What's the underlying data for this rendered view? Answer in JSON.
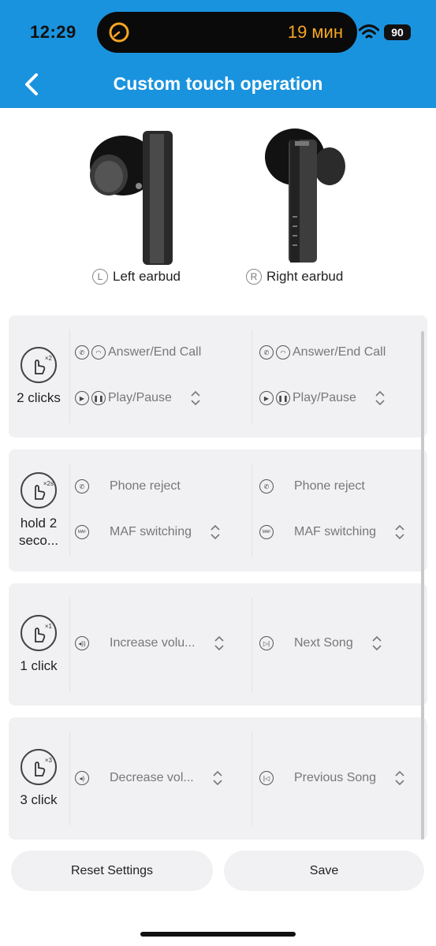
{
  "status": {
    "time": "12:29",
    "island_text": "19 мин",
    "battery": "90"
  },
  "header": {
    "title": "Custom touch operation"
  },
  "earbuds": {
    "left_letter": "L",
    "left_label": "Left earbud",
    "right_letter": "R",
    "right_label": "Right earbud"
  },
  "cards": [
    {
      "gesture_badge": "×2",
      "gesture_label": "2 clicks",
      "left": [
        {
          "icons": [
            "phone-icon",
            "hangup-icon"
          ],
          "text": "Answer/End Call"
        },
        {
          "icons": [
            "play-icon",
            "pause-icon"
          ],
          "text": "Play/Pause"
        }
      ],
      "right": [
        {
          "icons": [
            "phone-icon",
            "hangup-icon"
          ],
          "text": "Answer/End Call"
        },
        {
          "icons": [
            "play-icon",
            "pause-icon"
          ],
          "text": "Play/Pause"
        }
      ]
    },
    {
      "gesture_badge": "×2s",
      "gesture_label": "hold 2 seco...",
      "left": [
        {
          "icons": [
            "phone-icon"
          ],
          "text": "Phone reject"
        },
        {
          "icons": [
            "maf-icon"
          ],
          "icon_text": "MAF",
          "text": "MAF switching"
        }
      ],
      "right": [
        {
          "icons": [
            "phone-icon"
          ],
          "text": "Phone reject"
        },
        {
          "icons": [
            "maf-icon"
          ],
          "icon_text": "MAF",
          "text": "MAF switching"
        }
      ]
    },
    {
      "gesture_badge": "×1",
      "gesture_label": "1 click",
      "left": [
        {
          "icons": [
            "volume-up-icon"
          ],
          "text": "Increase volu..."
        }
      ],
      "right": [
        {
          "icons": [
            "next-song-icon"
          ],
          "text": "Next Song"
        }
      ]
    },
    {
      "gesture_badge": "×3",
      "gesture_label": "3 click",
      "left": [
        {
          "icons": [
            "volume-down-icon"
          ],
          "text": "Decrease vol..."
        }
      ],
      "right": [
        {
          "icons": [
            "previous-song-icon"
          ],
          "text": "Previous Song"
        }
      ]
    }
  ],
  "footer": {
    "reset_label": "Reset Settings",
    "save_label": "Save"
  },
  "colors": {
    "header": "#1a93df",
    "card": "#f1f1f4",
    "island_text": "#f5a623"
  }
}
